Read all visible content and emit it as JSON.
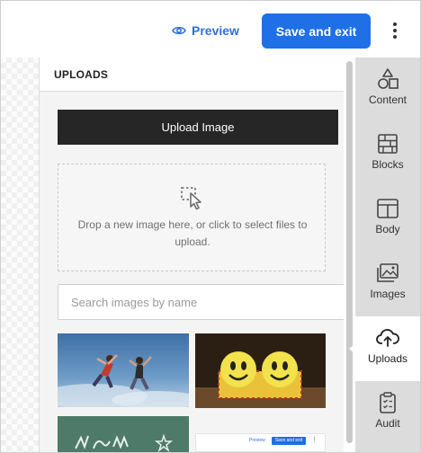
{
  "topbar": {
    "preview_label": "Preview",
    "save_label": "Save and exit",
    "accent": "#1f6fe6"
  },
  "panel": {
    "title": "UPLOADS",
    "upload_button": "Upload Image",
    "dropzone_text": "Drop a new image here, or click to select files to upload.",
    "search_placeholder": "Search images by name",
    "search_value": "",
    "thumbnail4": {
      "preview_label": "Preview",
      "save_label": "Save and exit"
    }
  },
  "rightnav": {
    "items": [
      {
        "label": "Content",
        "icon": "shapes-icon"
      },
      {
        "label": "Blocks",
        "icon": "brick-wall-icon"
      },
      {
        "label": "Body",
        "icon": "layout-icon"
      },
      {
        "label": "Images",
        "icon": "image-gallery-icon"
      },
      {
        "label": "Uploads",
        "icon": "cloud-upload-icon",
        "active": true
      },
      {
        "label": "Audit",
        "icon": "clipboard-check-icon"
      }
    ]
  }
}
